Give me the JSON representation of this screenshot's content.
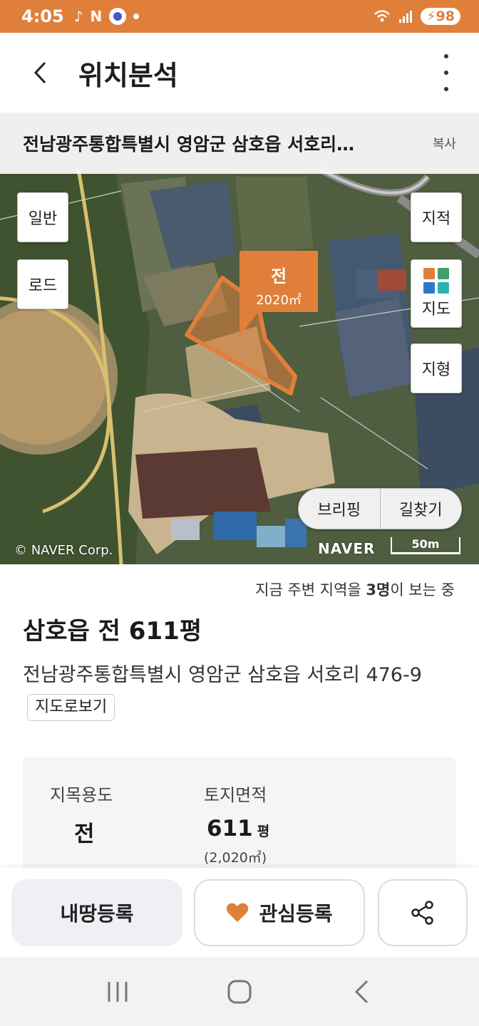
{
  "status_bar": {
    "time": "4:05",
    "battery": "98",
    "icons": [
      "notification-icon",
      "n-app-icon",
      "badge-icon",
      "dot-icon",
      "wifi-icon",
      "signal-icon",
      "battery-icon"
    ]
  },
  "header": {
    "title": "위치분석",
    "back_icon": "back-chevron-icon",
    "more_icon": "more-vertical-icon"
  },
  "address_bar": {
    "address": "전남광주통합특별시 영암군 삼호읍 서호리…",
    "copy_label": "복사"
  },
  "map": {
    "buttons": {
      "general": "일반",
      "road": "로드",
      "cadastral": "지적",
      "map_layer": "지도",
      "terrain": "지형"
    },
    "parcel_label": {
      "type": "전",
      "area": "2020㎡"
    },
    "pill_buttons": {
      "briefing": "브리핑",
      "directions": "길찾기"
    },
    "copyright": "© NAVER Corp.",
    "logo": "NAVER",
    "scale": "50m",
    "colors": {
      "parcel": "#E07F3A"
    }
  },
  "content": {
    "viewers_prefix": "지금 주변 지역을 ",
    "viewers_count": "3명",
    "viewers_suffix": "이 보는 중",
    "title": "삼호읍 전 611평",
    "address_line": "전남광주통합특별시 영암군 삼호읍 서호리 476-9",
    "map_view_button": "지도로보기"
  },
  "info_card": {
    "land_use_label": "지목용도",
    "land_use_value": "전",
    "area_label": "토지면적",
    "area_value": "611",
    "area_unit": "평",
    "area_sub": "(2,020㎡)"
  },
  "actions": {
    "register_mine": "내땅등록",
    "favorite": "관심등록",
    "favorite_icon": "heart-icon",
    "share_icon": "share-icon"
  },
  "colors": {
    "accent": "#E07F3A",
    "status_bar": "#E07F3A"
  },
  "nav_bar": {
    "icons": [
      "recent-apps-icon",
      "home-icon",
      "back-icon"
    ]
  }
}
